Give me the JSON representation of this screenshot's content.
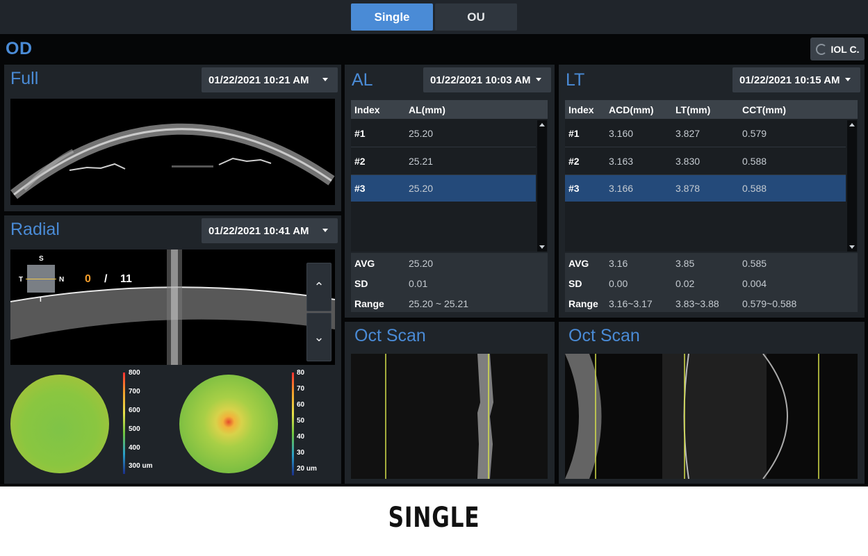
{
  "tabs": [
    {
      "label": "Single",
      "active": true
    },
    {
      "label": "OU",
      "active": false
    }
  ],
  "eye": "OD",
  "iol_button": "IOL C.",
  "full": {
    "title": "Full",
    "date": "01/22/2021 10:21 AM"
  },
  "radial": {
    "title": "Radial",
    "date": "01/22/2021 10:41 AM",
    "orientation": {
      "s": "S",
      "t": "T",
      "n": "N",
      "i": "I"
    },
    "current": "0",
    "separator": "/",
    "total": "11",
    "thickness_scale": [
      "800",
      "700",
      "600",
      "500",
      "400",
      "300 um"
    ],
    "epithelium_scale": [
      "80",
      "70",
      "60",
      "50",
      "40",
      "30",
      "20 um"
    ]
  },
  "al": {
    "title": "AL",
    "date": "01/22/2021 10:03 AM",
    "headers": [
      "Index",
      "AL(mm)"
    ],
    "rows": [
      {
        "index": "#1",
        "al": "25.20"
      },
      {
        "index": "#2",
        "al": "25.21"
      },
      {
        "index": "#3",
        "al": "25.20"
      }
    ],
    "selected_row": 2,
    "stats": [
      {
        "label": "AVG",
        "al": "25.20"
      },
      {
        "label": "SD",
        "al": "0.01"
      },
      {
        "label": "Range",
        "al": "25.20 ~ 25.21"
      }
    ]
  },
  "lt": {
    "title": "LT",
    "date": "01/22/2021 10:15 AM",
    "headers": [
      "Index",
      "ACD(mm)",
      "LT(mm)",
      "CCT(mm)"
    ],
    "rows": [
      {
        "index": "#1",
        "acd": "3.160",
        "lt": "3.827",
        "cct": "0.579"
      },
      {
        "index": "#2",
        "acd": "3.163",
        "lt": "3.830",
        "cct": "0.588"
      },
      {
        "index": "#3",
        "acd": "3.166",
        "lt": "3.878",
        "cct": "0.588"
      }
    ],
    "selected_row": 2,
    "stats": [
      {
        "label": "AVG",
        "acd": "3.16",
        "lt": "3.85",
        "cct": "0.585"
      },
      {
        "label": "SD",
        "acd": "0.00",
        "lt": "0.02",
        "cct": "0.004"
      },
      {
        "label": "Range",
        "acd": "3.16~3.17",
        "lt": "3.83~3.88",
        "cct": "0.579~0.588"
      }
    ]
  },
  "oct_left": {
    "title": "Oct Scan"
  },
  "oct_right": {
    "title": "Oct Scan"
  },
  "caption": "SINGLE",
  "colors": {
    "accent": "#4a8bd6",
    "selected": "#244a7a",
    "panel": "#1f2429"
  }
}
